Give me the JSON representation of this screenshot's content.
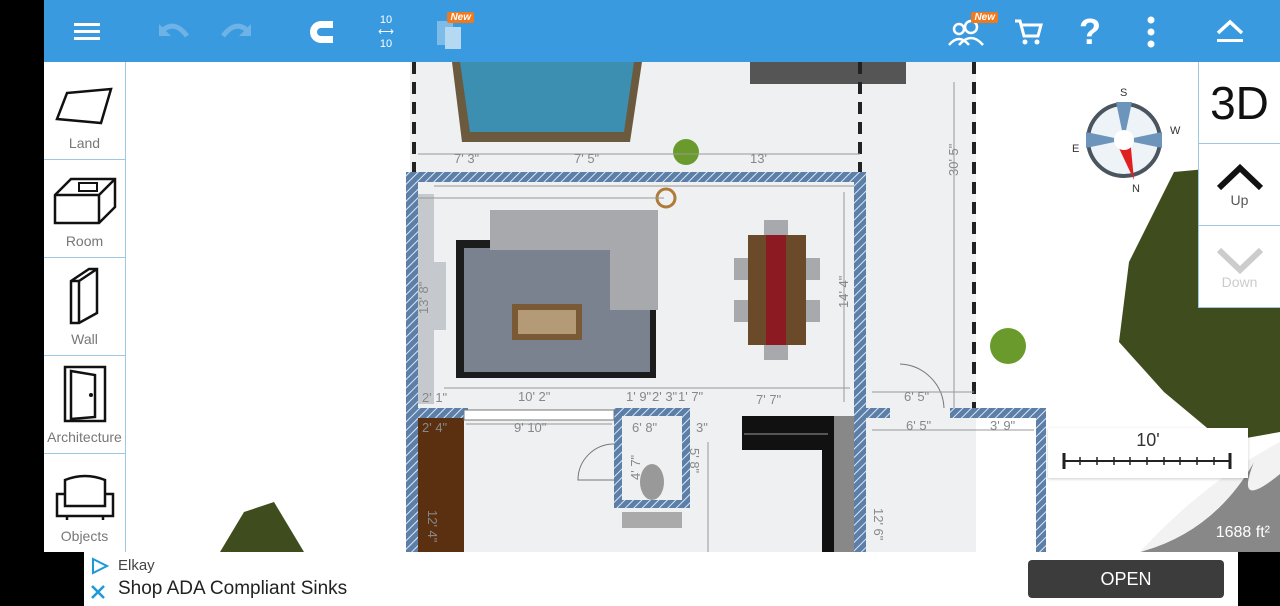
{
  "toolbar": {
    "items": [
      {
        "name": "menu",
        "icon": "hamburger-icon"
      },
      {
        "name": "undo",
        "icon": "undo-icon",
        "enabled": false
      },
      {
        "name": "redo",
        "icon": "redo-icon",
        "enabled": false
      },
      {
        "name": "magnet",
        "icon": "magnet-icon"
      },
      {
        "name": "dimensions",
        "icon": "dimension-icon",
        "label_top": "10",
        "label_bottom": "10"
      },
      {
        "name": "layers",
        "icon": "layers-icon",
        "badge": "New"
      },
      {
        "name": "community",
        "icon": "users-icon",
        "badge": "New"
      },
      {
        "name": "cart",
        "icon": "cart-icon"
      },
      {
        "name": "help",
        "icon": "help-icon",
        "label": "?"
      },
      {
        "name": "more",
        "icon": "more-vertical-icon"
      },
      {
        "name": "collapse",
        "icon": "chevron-up-icon"
      }
    ],
    "color": "#3a9ae0"
  },
  "left_panel": {
    "items": [
      {
        "label": "Land",
        "icon": "land-icon"
      },
      {
        "label": "Room",
        "icon": "room-icon"
      },
      {
        "label": "Wall",
        "icon": "wall-icon"
      },
      {
        "label": "Architecture",
        "icon": "door-icon"
      },
      {
        "label": "Objects",
        "icon": "armchair-icon"
      }
    ]
  },
  "right_panel": {
    "view_3d": "3D",
    "up": "Up",
    "down": "Down"
  },
  "compass": {
    "n": "N",
    "s": "S",
    "e": "E",
    "w": "W"
  },
  "scale_bar": {
    "label": "10'"
  },
  "area": "1688 ft²",
  "plan": {
    "dimensions": [
      "7' 3\"",
      "7' 5\"",
      "13'",
      "30' 5\"",
      "13' 8\"",
      "14' 4\"",
      "10' 2\"",
      "1' 9\"",
      "2' 3\"",
      "1' 7\"",
      "7' 7\"",
      "6' 5\"",
      "2' 1\"",
      "2' 4\"",
      "9' 10\"",
      "6' 8\"",
      "3\"",
      "4' 7\"",
      "5' 8\"",
      "6' 5\"",
      "3' 9\"",
      "12' 4\"",
      "12' 6\""
    ]
  },
  "ad": {
    "brand": "Elkay",
    "headline": "Shop ADA Compliant Sinks",
    "cta": "OPEN"
  }
}
